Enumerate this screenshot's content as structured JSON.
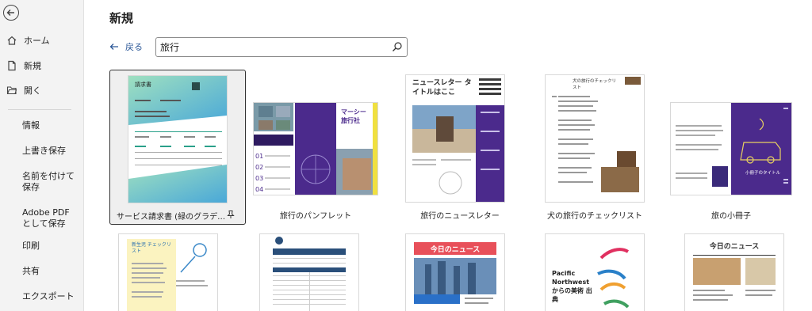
{
  "sidebar": {
    "items": [
      {
        "label": "ホーム",
        "icon": "home-icon"
      },
      {
        "label": "新規",
        "icon": "new-document-icon"
      },
      {
        "label": "開く",
        "icon": "folder-open-icon"
      },
      {
        "label": "情報"
      },
      {
        "label": "上書き保存"
      },
      {
        "label": "名前を付けて保存"
      },
      {
        "label": "Adobe PDF として保存"
      },
      {
        "label": "印刷"
      },
      {
        "label": "共有"
      },
      {
        "label": "エクスポート"
      }
    ]
  },
  "header": {
    "title": "新規",
    "back_label": "戻る"
  },
  "search": {
    "value": "旅行"
  },
  "templates": [
    {
      "caption": "サービス請求書 (緑のグラデ…",
      "selected": true
    },
    {
      "caption": "旅行のパンフレット"
    },
    {
      "caption": "旅行のニュースレター"
    },
    {
      "caption": "犬の旅行のチェックリスト"
    },
    {
      "caption": "旅の小冊子"
    }
  ],
  "thumb_text": {
    "invoice_title": "請求書",
    "brochure_title": "マーシー旅行社",
    "newsletter_title": "ニュースレター タイトルはここ",
    "checklist_title": "犬の旅行のチェックリスト",
    "booklet_title": "小冊子のタイトル",
    "row2_1": "新生児 チェックリスト",
    "row2_3": "今日のニュース",
    "row2_4": "Pacific Northwest からの美術 出典",
    "row2_5": "今日のニュース"
  },
  "colors": {
    "accent_blue": "#2b5797",
    "purple": "#4b2a8c",
    "teal": "#49c0a8",
    "selection_border": "#333333"
  }
}
